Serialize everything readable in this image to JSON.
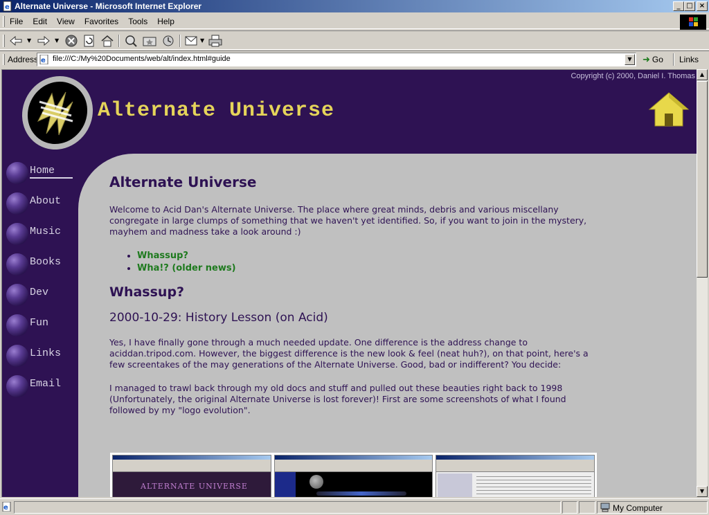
{
  "window": {
    "title": "Alternate Universe - Microsoft Internet Explorer",
    "minimize": "_",
    "maximize": "□",
    "close": "×"
  },
  "menu": {
    "items": [
      "File",
      "Edit",
      "View",
      "Favorites",
      "Tools",
      "Help"
    ]
  },
  "toolbar": {
    "icons": [
      "back-icon",
      "forward-icon",
      "stop-icon",
      "refresh-icon",
      "home-icon",
      "search-icon",
      "favorites-icon",
      "history-icon",
      "mail-icon",
      "print-icon"
    ]
  },
  "address": {
    "label": "Address",
    "url": "file:///C:/My%20Documents/web/alt/index.html#guide",
    "go_label": "Go",
    "links_label": "Links"
  },
  "page": {
    "copyright": "Copyright (c) 2000, Daniel I. Thomas",
    "site_title": "Alternate Universe",
    "nav": [
      "Home",
      "About",
      "Music",
      "Books",
      "Dev",
      "Fun",
      "Links",
      "Email"
    ],
    "heading": "Alternate Universe",
    "intro": "Welcome to Acid Dan's Alternate Universe. The place where great minds, debris and various miscellany congregate in large clumps of something that we haven't yet identified. So, if you want to join in the mystery, mayhem and madness take a look around :)",
    "links": [
      "Whassup?",
      "Wha!? (older news)"
    ],
    "section_title": "Whassup?",
    "post_title": "2000-10-29: History Lesson (on Acid)",
    "post_p1": "Yes, I have finally gone through a much needed update. One difference is the address change to aciddan.tripod.com. However, the biggest difference is the new look & feel (neat huh?), on that point, here's a few screentakes of the may generations of the Alternate Universe. Good, bad or indifferent? You decide:",
    "post_p2": "I managed to trawl back through my old docs and stuff and pulled out these beauties right back to 1998 (Unfortunately, the original Alternate Universe is lost forever)! First are some screenshots of what I found followed by my \"logo evolution\".",
    "thumb1_label": "ALTERNATE UNIVERSE"
  },
  "status": {
    "zone": "My Computer"
  },
  "colors": {
    "brand_purple": "#2e1253",
    "title_yellow": "#e5d45a",
    "link_green": "#1e7a1e",
    "content_bg": "#c0c0c0"
  }
}
